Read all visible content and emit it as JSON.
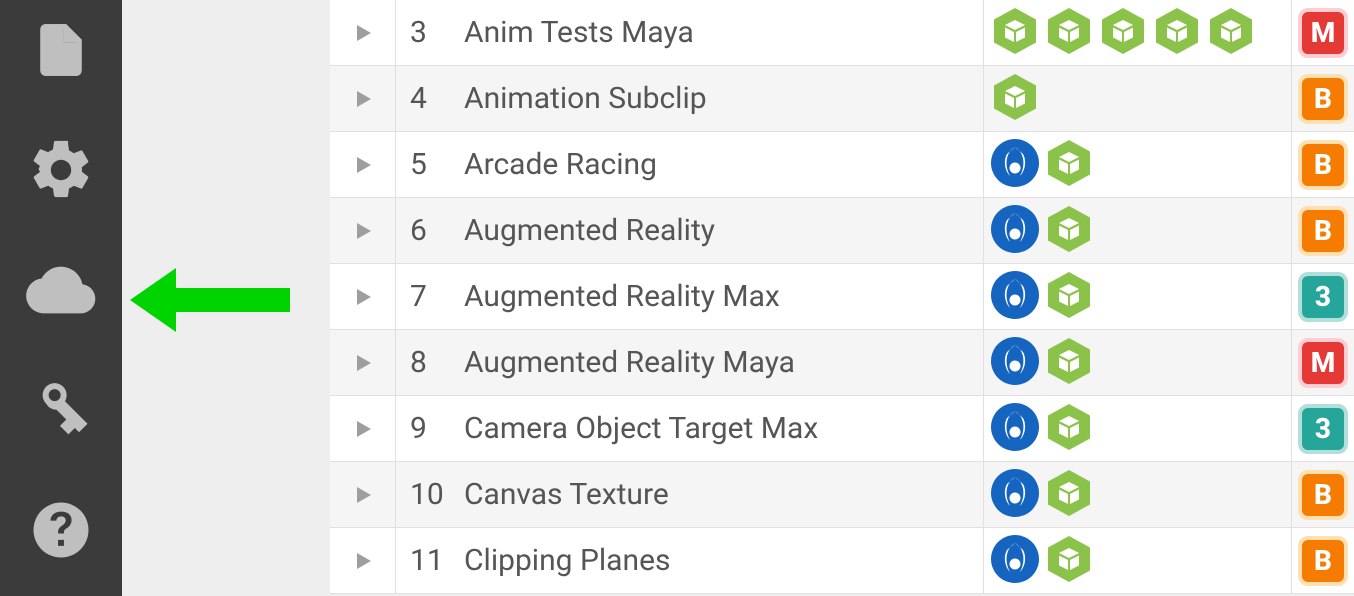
{
  "sidebar": {
    "items": [
      {
        "name": "document-icon"
      },
      {
        "name": "gear-icon"
      },
      {
        "name": "cloud-icon"
      },
      {
        "name": "key-icon"
      },
      {
        "name": "help-icon"
      }
    ]
  },
  "annotation": {
    "arrow_target": "cloud-icon",
    "arrow_color": "#00d400"
  },
  "colors": {
    "hex_green": "#8bc34a",
    "circle_blue": "#1565c0",
    "engine_M": "#e53935",
    "engine_B": "#f57c00",
    "engine_3": "#26a69a"
  },
  "rows": [
    {
      "num": "3",
      "name": "Anim Tests Maya",
      "icons": [
        "hex",
        "hex",
        "hex",
        "hex",
        "hex"
      ],
      "engine": "M"
    },
    {
      "num": "4",
      "name": "Animation Subclip",
      "icons": [
        "hex"
      ],
      "engine": "B"
    },
    {
      "num": "5",
      "name": "Arcade Racing",
      "icons": [
        "circle",
        "hex"
      ],
      "engine": "B"
    },
    {
      "num": "6",
      "name": "Augmented Reality",
      "icons": [
        "circle",
        "hex"
      ],
      "engine": "B"
    },
    {
      "num": "7",
      "name": "Augmented Reality Max",
      "icons": [
        "circle",
        "hex"
      ],
      "engine": "3"
    },
    {
      "num": "8",
      "name": "Augmented Reality Maya",
      "icons": [
        "circle",
        "hex"
      ],
      "engine": "M"
    },
    {
      "num": "9",
      "name": "Camera Object Target Max",
      "icons": [
        "circle",
        "hex"
      ],
      "engine": "3"
    },
    {
      "num": "10",
      "name": "Canvas Texture",
      "icons": [
        "circle",
        "hex"
      ],
      "engine": "B"
    },
    {
      "num": "11",
      "name": "Clipping Planes",
      "icons": [
        "circle",
        "hex"
      ],
      "engine": "B"
    }
  ]
}
